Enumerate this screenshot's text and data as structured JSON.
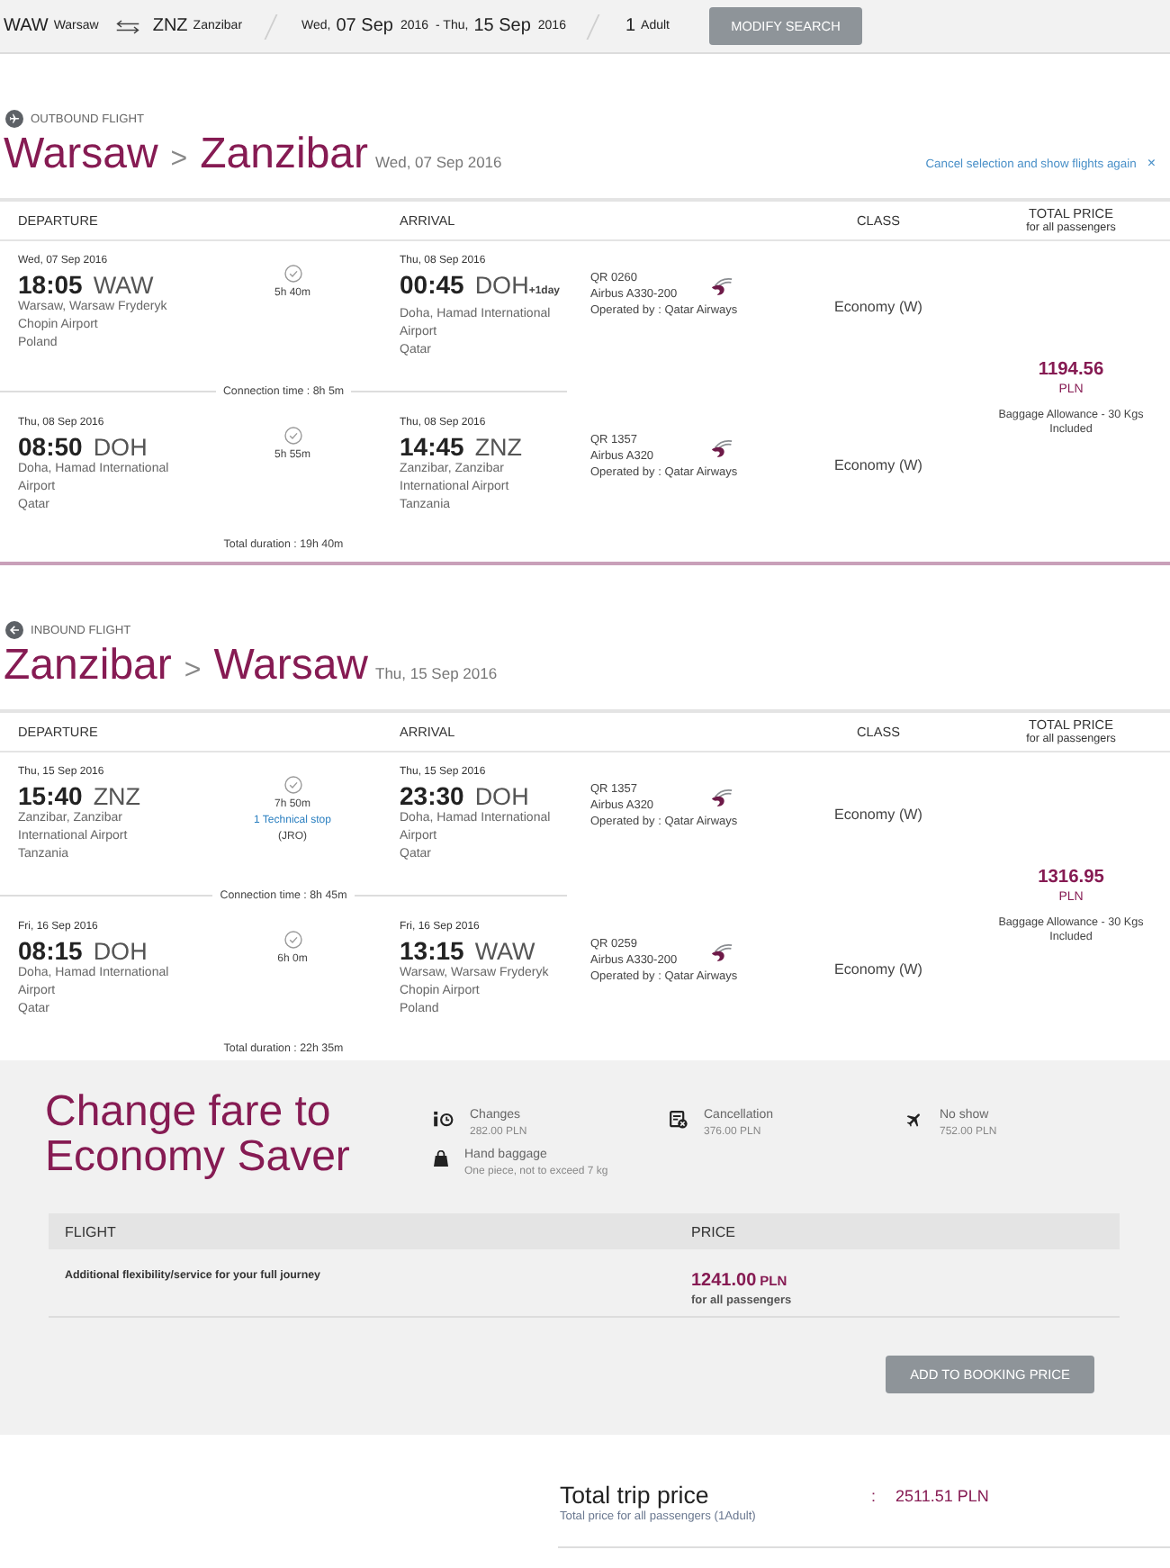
{
  "search_bar": {
    "origin": {
      "code": "WAW",
      "city": "Warsaw"
    },
    "destination": {
      "code": "ZNZ",
      "city": "Zanzibar"
    },
    "dates": [
      {
        "weekday": "Wed,",
        "day": "07 Sep",
        "year": "2016"
      },
      {
        "weekday": "- Thu,",
        "day": "15 Sep",
        "year": "2016"
      }
    ],
    "passengers": {
      "count": "1",
      "label": "Adult"
    },
    "button": "MODIFY SEARCH"
  },
  "journeys": [
    {
      "kind": "outbound",
      "label": "OUTBOUND FLIGHT",
      "route": {
        "from": "Warsaw",
        "separator": ">",
        "to": "Zanzibar",
        "date": "Wed, 07 Sep 2016"
      },
      "cancel": {
        "label": "Cancel selection and show flights again",
        "close": "×"
      },
      "columns": [
        "DEPARTURE",
        "ARRIVAL",
        "CLASS",
        "TOTAL PRICE"
      ],
      "columns_note": "for all passengers",
      "segments": [
        {
          "departure": {
            "date": "Wed, 07 Sep 2016",
            "time": "18:05",
            "code": "WAW",
            "airport": "Warsaw, Warsaw Fryderyk Chopin Airport",
            "country": "Poland"
          },
          "duration": "5h 40m",
          "arrival": {
            "date": "Thu, 08 Sep 2016",
            "time": "00:45",
            "code": "DOH",
            "day_offset": "+1day",
            "airport": "Doha, Hamad International Airport",
            "country": "Qatar"
          },
          "flight": {
            "number": "QR 0260",
            "aircraft": "Airbus A330-200",
            "operator": "Operated by : Qatar Airways"
          },
          "fare_class": "Economy (W)"
        },
        {
          "departure": {
            "date": "Thu, 08 Sep 2016",
            "time": "08:50",
            "code": "DOH",
            "airport": "Doha, Hamad International Airport",
            "country": "Qatar"
          },
          "duration": "5h 55m",
          "arrival": {
            "date": "Thu, 08 Sep 2016",
            "time": "14:45",
            "code": "ZNZ",
            "airport": "Zanzibar, Zanzibar International Airport",
            "country": "Tanzania"
          },
          "flight": {
            "number": "QR 1357",
            "aircraft": "Airbus A320",
            "operator": "Operated by : Qatar Airways"
          },
          "fare_class": "Economy (W)"
        }
      ],
      "connections": [
        "Connection time : 8h 5m"
      ],
      "total_duration": "Total duration : 19h 40m",
      "price": {
        "amount": "1194.56",
        "currency": "PLN",
        "baggage": "Baggage Allowance - 30 Kgs Included"
      }
    },
    {
      "kind": "inbound",
      "label": "INBOUND FLIGHT",
      "route": {
        "from": "Zanzibar",
        "separator": ">",
        "to": "Warsaw",
        "date": "Thu, 15 Sep 2016"
      },
      "columns": [
        "DEPARTURE",
        "ARRIVAL",
        "CLASS",
        "TOTAL PRICE"
      ],
      "columns_note": "for all passengers",
      "segments": [
        {
          "departure": {
            "date": "Thu, 15 Sep 2016",
            "time": "15:40",
            "code": "ZNZ",
            "airport": "Zanzibar, Zanzibar International Airport",
            "country": "Tanzania"
          },
          "duration": "7h 50m",
          "stop": {
            "label": "1 Technical stop",
            "airport": "(JRO)"
          },
          "arrival": {
            "date": "Thu, 15 Sep 2016",
            "time": "23:30",
            "code": "DOH",
            "airport": "Doha, Hamad International Airport",
            "country": "Qatar"
          },
          "flight": {
            "number": "QR 1357",
            "aircraft": "Airbus A320",
            "operator": "Operated by : Qatar Airways"
          },
          "fare_class": "Economy (W)"
        },
        {
          "departure": {
            "date": "Fri, 16 Sep 2016",
            "time": "08:15",
            "code": "DOH",
            "airport": "Doha, Hamad International Airport",
            "country": "Qatar"
          },
          "duration": "6h 0m",
          "arrival": {
            "date": "Fri, 16 Sep 2016",
            "time": "13:15",
            "code": "WAW",
            "airport": "Warsaw, Warsaw Fryderyk Chopin Airport",
            "country": "Poland"
          },
          "flight": {
            "number": "QR 0259",
            "aircraft": "Airbus A330-200",
            "operator": "Operated by : Qatar Airways"
          },
          "fare_class": "Economy (W)"
        }
      ],
      "connections": [
        "Connection time : 8h 45m"
      ],
      "total_duration": "Total duration : 22h 35m",
      "price": {
        "amount": "1316.95",
        "currency": "PLN",
        "baggage": "Baggage Allowance - 30 Kgs Included"
      }
    }
  ],
  "fare_offer": {
    "title": "Change fare to Economy Saver",
    "features": [
      {
        "kind": "changes",
        "name": "Changes",
        "value": "282.00 PLN"
      },
      {
        "kind": "cancellation",
        "name": "Cancellation",
        "value": "376.00 PLN"
      },
      {
        "kind": "no_show",
        "name": "No show",
        "value": "752.00 PLN"
      },
      {
        "kind": "hand_baggage",
        "name": "Hand baggage",
        "value": "One piece, not to exceed 7 kg"
      }
    ],
    "table": {
      "columns": [
        "FLIGHT",
        "PRICE"
      ],
      "rows": [
        {
          "description": "Additional flexibility/service for your full journey",
          "price": {
            "amount": "1241.00",
            "currency": "PLN",
            "note": "for all passengers"
          }
        }
      ]
    },
    "button": "ADD TO BOOKING PRICE"
  },
  "trip_total": {
    "label": "Total trip price",
    "note": "Total price for all passengers (1Adult)",
    "separator": ":",
    "amount": "2511.51 PLN"
  }
}
